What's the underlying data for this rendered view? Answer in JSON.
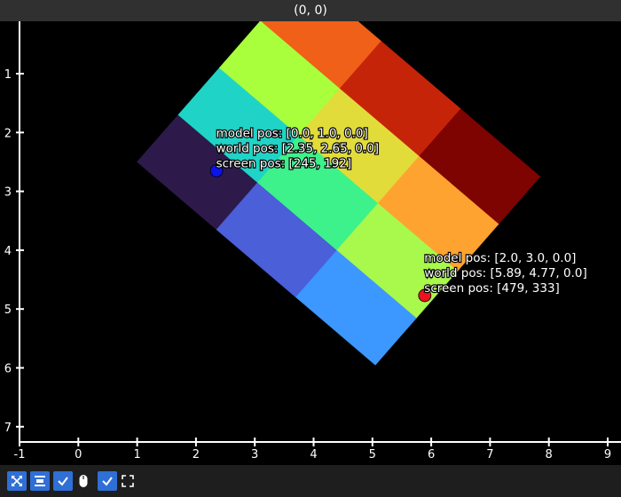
{
  "window": {
    "title": "(0, 0)"
  },
  "plot": {
    "x_ticks": [
      -1,
      0,
      1,
      2,
      3,
      4,
      5,
      6,
      7,
      8,
      9
    ],
    "y_ticks": [
      1,
      2,
      3,
      4,
      5,
      6,
      7
    ],
    "xlim": [
      -1,
      9
    ],
    "ylim": [
      0.5,
      7.5
    ],
    "y_inverted": true,
    "grid": false
  },
  "chart_data": {
    "type": "heatmap",
    "title": "",
    "xlabel": "",
    "ylabel": "",
    "grid_shape": [
      4,
      3
    ],
    "transform": {
      "origin": [
        1.0,
        2.5
      ],
      "u": [
        1.35,
        1.15
      ],
      "v": [
        0.7,
        -0.8
      ]
    },
    "cells": [
      {
        "i": 0,
        "j": 0,
        "color": "#2d1a4a"
      },
      {
        "i": 0,
        "j": 1,
        "color": "#1fd4c6"
      },
      {
        "i": 0,
        "j": 2,
        "color": "#a9ff3c"
      },
      {
        "i": 0,
        "j": 3,
        "color": "#f06018"
      },
      {
        "i": 1,
        "j": 0,
        "color": "#4a5fd8"
      },
      {
        "i": 1,
        "j": 1,
        "color": "#3df28a"
      },
      {
        "i": 1,
        "j": 2,
        "color": "#e2dc3a"
      },
      {
        "i": 1,
        "j": 3,
        "color": "#c62408"
      },
      {
        "i": 2,
        "j": 0,
        "color": "#3c97ff"
      },
      {
        "i": 2,
        "j": 1,
        "color": "#a9f84c"
      },
      {
        "i": 2,
        "j": 2,
        "color": "#ffa330"
      },
      {
        "i": 2,
        "j": 3,
        "color": "#7e0402"
      }
    ],
    "markers": [
      {
        "x": 2.35,
        "y": 2.65,
        "color": "#0a14e6",
        "labels": [
          "model pos: [0.0, 1.0, 0.0]",
          "world pos: [2.35, 2.65, 0.0]",
          "screen pos: [245, 192]"
        ]
      },
      {
        "x": 5.89,
        "y": 4.77,
        "color": "#e8141e",
        "labels": [
          "model pos: [2.0, 3.0, 0.0]",
          "world pos: [5.89, 4.77, 0.0]",
          "screen pos: [479, 333]"
        ]
      }
    ]
  },
  "toolbar": {
    "items": [
      {
        "name": "autoscale-button-icon",
        "style": "blue"
      },
      {
        "name": "align-icon",
        "style": "blue"
      },
      {
        "name": "checkbox-checked-icon",
        "style": "blue"
      },
      {
        "name": "mouse-icon",
        "style": "plain"
      },
      {
        "name": "checkbox-checked-icon",
        "style": "blue"
      },
      {
        "name": "fullscreen-icon",
        "style": "plain"
      }
    ]
  },
  "colors": {
    "background": "#000000",
    "titlebar": "#303030",
    "toolbar": "#1e1e1e",
    "accent": "#2f6fd6",
    "axis": "#ffffff"
  }
}
